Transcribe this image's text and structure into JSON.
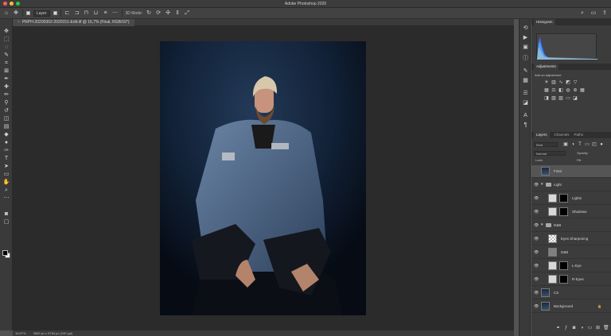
{
  "window": {
    "title": "Adobe Photoshop 2020",
    "traffic_colors": [
      "#ff5f57",
      "#febc2e",
      "#28c840"
    ]
  },
  "options_bar": {
    "auto_select_value": "Layer",
    "show_transform_label": "3D Mode:"
  },
  "document": {
    "tab_title": "PRPH-20200302-2020151-Edit.tif @ 16,7% (Final, RGB/16*)",
    "close_glyph": "×"
  },
  "status": {
    "zoom": "16,67%",
    "doc_info": "3669 px x 5784 px (240 ppi)"
  },
  "panels": {
    "histogram_tab": "Histogram",
    "adjustments_tab": "Adjustments",
    "adjustments_subtitle": "Add an adjustment",
    "layer_tabs": [
      "Layers",
      "Channels",
      "Paths"
    ],
    "kind_filter": "Kind",
    "blend_mode": "Normal",
    "opacity_label": "Opacity:",
    "lock_label": "Lock:",
    "fill_label": "Fill:"
  },
  "layers": [
    {
      "name": "Final",
      "indent": 0,
      "type": "pixel",
      "selected": true,
      "visible": false
    },
    {
      "name": "Light",
      "indent": 0,
      "type": "group",
      "visible": true
    },
    {
      "name": "Lights",
      "indent": 1,
      "type": "adjustment",
      "visible": true
    },
    {
      "name": "Shadows",
      "indent": 1,
      "type": "adjustment",
      "visible": true
    },
    {
      "name": "D&B",
      "indent": 0,
      "type": "group",
      "visible": true
    },
    {
      "name": "Eyes Sharpening",
      "indent": 1,
      "type": "pixel-checker",
      "visible": true
    },
    {
      "name": "D&B",
      "indent": 1,
      "type": "pixel-gray",
      "visible": true
    },
    {
      "name": "L-Eye",
      "indent": 1,
      "type": "adjustment",
      "visible": true
    },
    {
      "name": "R-Eyes",
      "indent": 1,
      "type": "adjustment",
      "visible": true
    },
    {
      "name": "CS",
      "indent": 0,
      "type": "pixel",
      "visible": true
    },
    {
      "name": "Background",
      "indent": 0,
      "type": "pixel",
      "visible": true,
      "locked": true
    }
  ]
}
